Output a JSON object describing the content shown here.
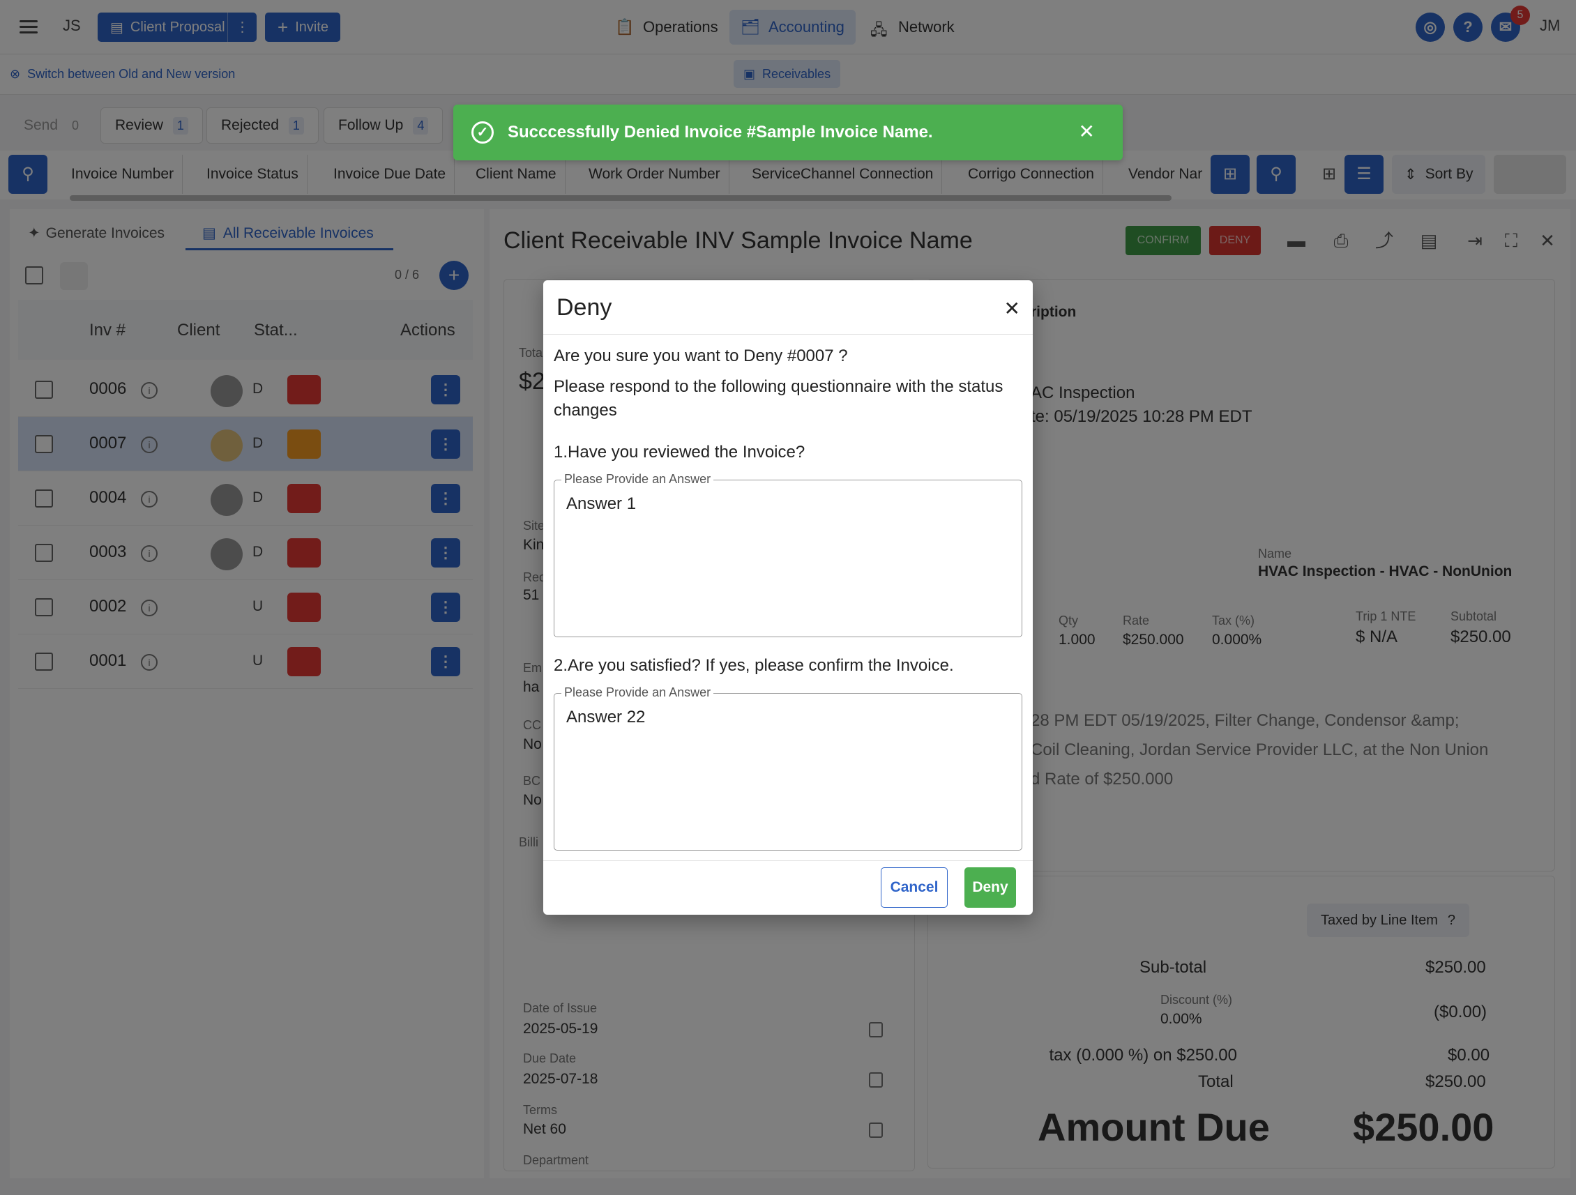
{
  "topbar": {
    "user_initials": "JS",
    "client_proposal": "Client Proposal",
    "invite": "Invite",
    "nav": [
      "Operations",
      "Accounting",
      "Network"
    ],
    "notifications": "5",
    "account_initials": "JM"
  },
  "subbar": {
    "switch_link": "Switch between Old and New version",
    "receivables": "Receivables"
  },
  "status_tabs": [
    {
      "label": "Send",
      "count": "0"
    },
    {
      "label": "Review",
      "count": "1"
    },
    {
      "label": "Rejected",
      "count": "1"
    },
    {
      "label": "Follow Up",
      "count": "4"
    }
  ],
  "columns": [
    "Invoice Number",
    "Invoice Status",
    "Invoice Due Date",
    "Client Name",
    "Work Order Number",
    "ServiceChannel Connection",
    "Corrigo Connection",
    "Vendor Nar"
  ],
  "sort_by": "Sort By",
  "left": {
    "tab_generate": "Generate Invoices",
    "tab_all": "All Receivable Invoices",
    "count": "0 / 6",
    "headers": {
      "inv": "Inv #",
      "client": "Client",
      "status": "Stat...",
      "actions": "Actions"
    },
    "rows": [
      {
        "num": "0006",
        "letter": "D"
      },
      {
        "num": "0007",
        "letter": "D"
      },
      {
        "num": "0004",
        "letter": "D"
      },
      {
        "num": "0003",
        "letter": "D"
      },
      {
        "num": "0002",
        "letter": "U"
      },
      {
        "num": "0001",
        "letter": "U"
      }
    ]
  },
  "detail": {
    "title": "Client Receivable INV Sample Invoice Name",
    "confirm": "CONFIRM",
    "deny": "DENY",
    "description_label": "ription",
    "desc_line1": "AC Inspection",
    "desc_line2": "te: 05/19/2025 10:28 PM EDT",
    "line_name_label": "Name",
    "line_name": "HVAC Inspection - HVAC - NonUnion",
    "qty_label": "Qty",
    "qty": "1.000",
    "rate_label": "Rate",
    "rate": "$250.000",
    "tax_label": "Tax (%)",
    "tax": "0.000%",
    "nte_label": "Trip 1 NTE",
    "nte": "$ N/A",
    "subtotal_label": "Subtotal",
    "subtotal": "$250.00",
    "notes_1": "28 PM EDT 05/19/2025, Filter Change, Condensor &amp;",
    "notes_2": "Coil Cleaning, Jordan Service Provider LLC, at the Non Union",
    "notes_3": "d Rate of $250.000",
    "taxed_by": "Taxed by Line Item",
    "sub_total_label": "Sub-total",
    "sub_total": "$250.00",
    "discount_label": "Discount (%)",
    "discount_pct": "0.00%",
    "discount": "($0.00)",
    "tax_line_label": "tax (0.000 %) on $250.00",
    "tax_line": "$0.00",
    "total_label": "Total",
    "total": "$250.00",
    "amount_due_label": "Amount Due",
    "amount_due": "$250.00",
    "date_issue_label": "Date of Issue",
    "date_issue": "2025-05-19",
    "due_date_label": "Due Date",
    "due_date": "2025-07-18",
    "terms_label": "Terms",
    "terms": "Net 60",
    "department_label": "Department",
    "left_partial": {
      "total": "Tota",
      "amount": "$2",
      "site": "Site",
      "site_v": "Kin",
      "rec": "Rec",
      "rec_v": "51",
      "em": "Em",
      "em_v": "ha",
      "cc": "CC",
      "cc_v": "No",
      "bcc": "BC",
      "bcc_v": "No",
      "bill": "Billi"
    }
  },
  "toast": {
    "message": "Succcessfully Denied Invoice #Sample Invoice Name."
  },
  "modal": {
    "title": "Deny",
    "question": "Are you sure you want to Deny #0007 ?",
    "instruction": "Please respond to the following questionnaire with the status changes",
    "q1": "1.Have you reviewed the Invoice?",
    "q1_legend": "Please Provide an Answer",
    "q1_answer": "Answer 1",
    "q2": "2.Are you satisfied? If yes, please confirm the Invoice.",
    "q2_legend": "Please Provide an Answer",
    "q2_answer": "Answer 22",
    "cancel": "Cancel",
    "deny": "Deny"
  },
  "colors": {
    "primary": "#2f64c9",
    "success": "#4caf50",
    "danger": "#d9352f"
  }
}
